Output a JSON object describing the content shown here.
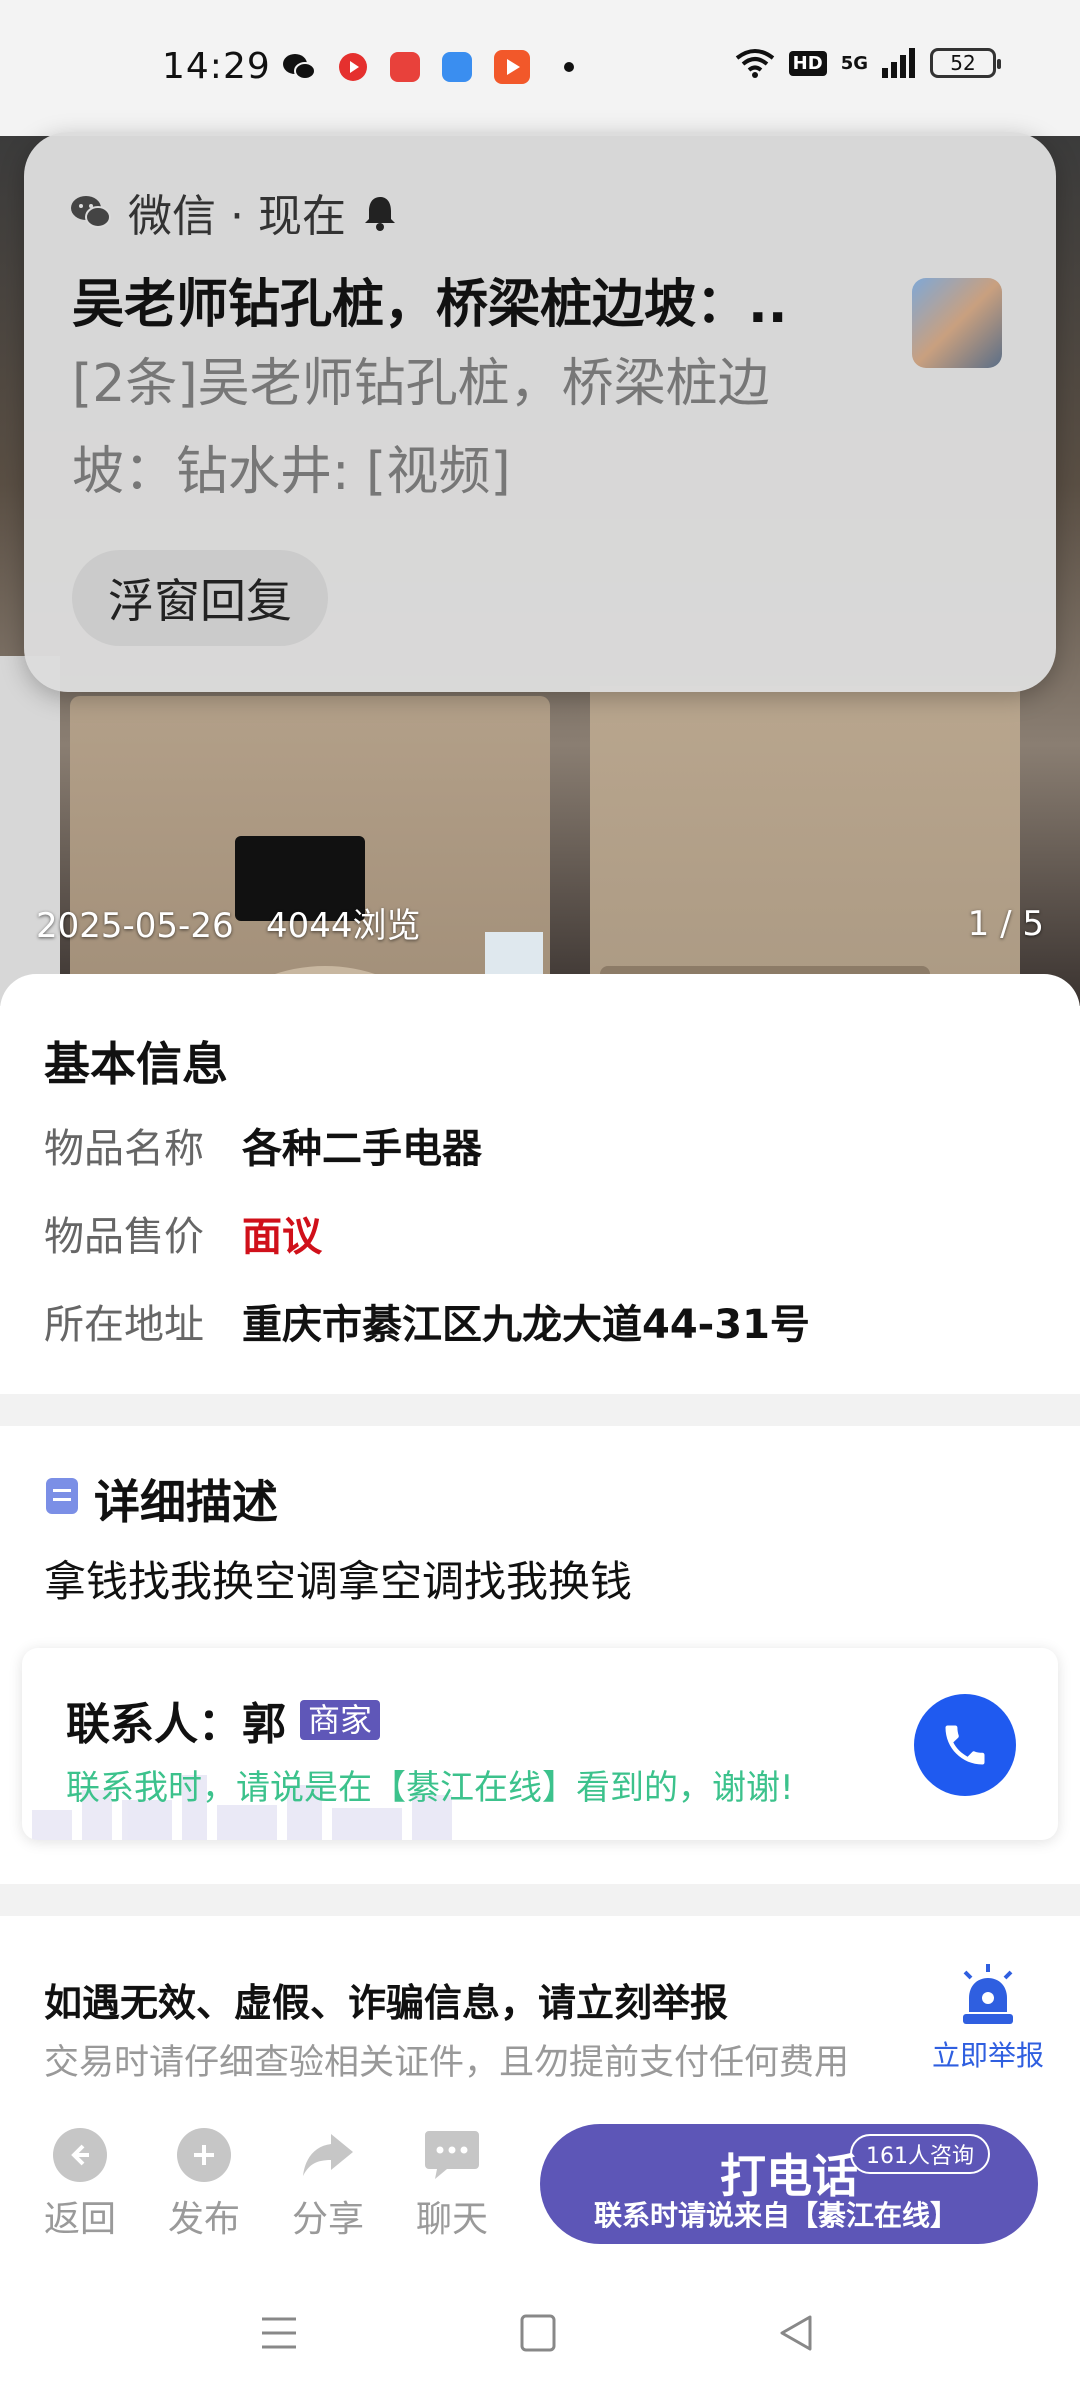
{
  "status_bar": {
    "time": "14:29",
    "network": "5G",
    "hd": "HD",
    "battery": "52"
  },
  "notification": {
    "app_name": "微信 · 现在",
    "title": "吴老师钻孔桩，桥梁桩边坡：..",
    "body": "[2条]吴老师钻孔桩，桥梁桩边坡：钻水井: [视频]",
    "reply_button": "浮窗回复"
  },
  "gallery": {
    "date": "2025-05-26",
    "views": "4044浏览",
    "counter": "1 / 5"
  },
  "basic_info": {
    "title": "基本信息",
    "rows": [
      {
        "label": "物品名称",
        "value": "各种二手电器"
      },
      {
        "label": "物品售价",
        "value": "面议"
      },
      {
        "label": "所在地址",
        "value": "重庆市綦江区九龙大道44-31号"
      }
    ]
  },
  "description": {
    "title": "详细描述",
    "text": "拿钱找我换空调拿空调找我换钱"
  },
  "contact": {
    "label": "联系人：郭",
    "badge": "商家",
    "hint": "联系我时，请说是在【綦江在线】看到的，谢谢!"
  },
  "report": {
    "title": "如遇无效、虚假、诈骗信息，请立刻举报",
    "subtitle": "交易时请仔细查验相关证件，且勿提前支付任何费用",
    "button": "立即举报"
  },
  "bottom_nav": {
    "items": [
      {
        "label": "返回",
        "icon": "back-arrow-icon"
      },
      {
        "label": "发布",
        "icon": "plus-icon"
      },
      {
        "label": "分享",
        "icon": "share-icon"
      },
      {
        "label": "聊天",
        "icon": "chat-icon"
      }
    ],
    "call": {
      "title": "打电话",
      "count": "161人咨询",
      "subtitle": "联系时请说来自【綦江在线】"
    }
  },
  "colors": {
    "accent": "#5d56b7",
    "price": "#d0101a",
    "hint": "#3cc28c",
    "call_blue": "#1f5af0"
  }
}
